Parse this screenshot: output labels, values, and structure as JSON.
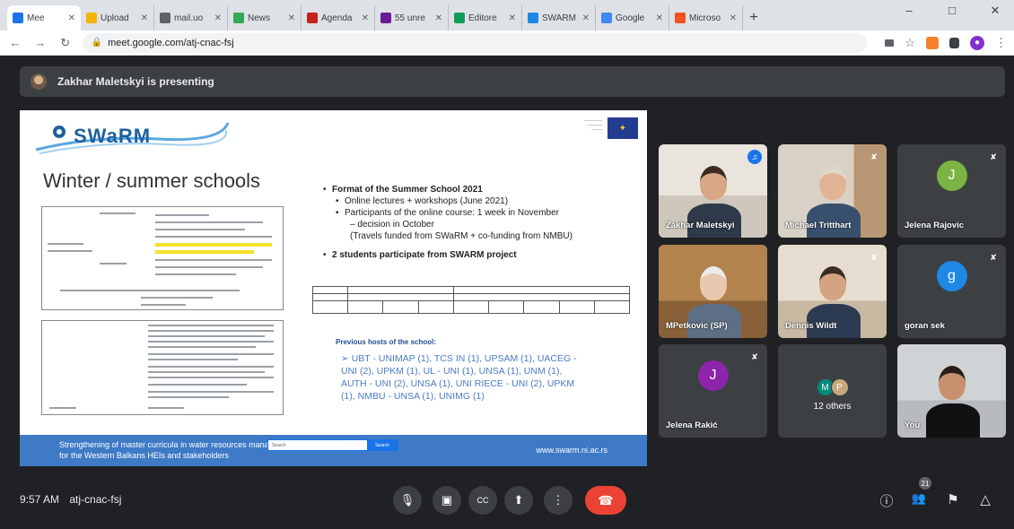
{
  "browser": {
    "tabs": [
      {
        "label": "Mee",
        "color": "#1a73e8",
        "active": true
      },
      {
        "label": "Upload",
        "color": "#f4b400"
      },
      {
        "label": "mail.uo",
        "color": "#5f6368"
      },
      {
        "label": "News",
        "color": "#34a853"
      },
      {
        "label": "Agenda",
        "color": "#c5221f"
      },
      {
        "label": "55 unre",
        "color": "#6a1b9a"
      },
      {
        "label": "Editore",
        "color": "#0f9d58"
      },
      {
        "label": "SWARM",
        "color": "#1e88e5"
      },
      {
        "label": "Google",
        "color": "#4285f4"
      },
      {
        "label": "Microso",
        "color": "#f25022"
      }
    ],
    "new_tab": "+",
    "window_controls": [
      "–",
      "□",
      "✕"
    ],
    "url": "meet.google.com/atj-cnac-fsj",
    "nav": {
      "back": "←",
      "forward": "→",
      "reload": "↻"
    }
  },
  "meet": {
    "presenter_text": "Zakhar Maletskyi is presenting",
    "slide": {
      "logo_text": "SWaRM",
      "title": "Winter / summer schools",
      "bullets": [
        {
          "text": "Format of the Summer School 2021",
          "level": 0,
          "bold": true
        },
        {
          "text": "Online lectures + workshops (June 2021)",
          "level": 1
        },
        {
          "text": "Participants of the online course: 1 week in November",
          "level": 1
        },
        {
          "text": "– decision in October",
          "level": 2
        },
        {
          "text": "(Travels funded from SWaRM + co-funding from NMBU)",
          "level": 2
        },
        {
          "text": "2 students participate from SWARM project",
          "level": 0,
          "bold": true
        }
      ],
      "hosts_title": "Previous hosts of the school:",
      "hosts_text": "➢ UBT - UNIMAP (1), TCS IN (1), UPSAM (1), UACEG - UNI (2), UPKM (1), UL - UNI (1), UNSA (1), UNM (1), AUTH - UNI (2), UNSA (1), UNI RIECE - UNI (2), UPKM (1), NMBU - UNSA (1), UNIMG (1)",
      "footer_text": "Strengthening of master curricula in water resources management for the Western Balkans HEIs and stakeholders",
      "footer_url": "www.swarm.ni.ac.rs",
      "search_placeholder": "Search",
      "search_button": "Search"
    },
    "participants": [
      {
        "name": "Zakhar Maletskyi",
        "speaking": true,
        "type": "video"
      },
      {
        "name": "Michael Tritthart",
        "type": "video",
        "muted": true
      },
      {
        "name": "Jelena Rajovic",
        "type": "avatar",
        "initial": "J",
        "color": "#7cb342",
        "muted": true
      },
      {
        "name": "MPetkovic (SP)",
        "type": "video"
      },
      {
        "name": "Dennis Wildt",
        "type": "video",
        "muted": true
      },
      {
        "name": "goran sek",
        "type": "avatar",
        "initial": "g",
        "color": "#1e88e5",
        "muted": true
      },
      {
        "name": "Jelena Rakić",
        "type": "avatar",
        "initial": "J",
        "color": "#8e24aa",
        "muted": true
      },
      {
        "name": "12 others",
        "type": "others",
        "initials": [
          "M",
          "P"
        ],
        "colors": [
          "#00897b",
          "#c9a77b"
        ]
      },
      {
        "name": "You",
        "type": "video"
      }
    ],
    "clock": "9:57 AM",
    "meeting_code": "atj-cnac-fsj",
    "controls": {
      "mic": "🎙",
      "camera": "▣",
      "captions": "CC",
      "present": "⬆",
      "more": "⋮",
      "end_call": "☎"
    },
    "right_controls": {
      "info": "ⓘ",
      "people": "👥",
      "people_count": "21",
      "chat": "⚑",
      "activities": "△"
    }
  }
}
